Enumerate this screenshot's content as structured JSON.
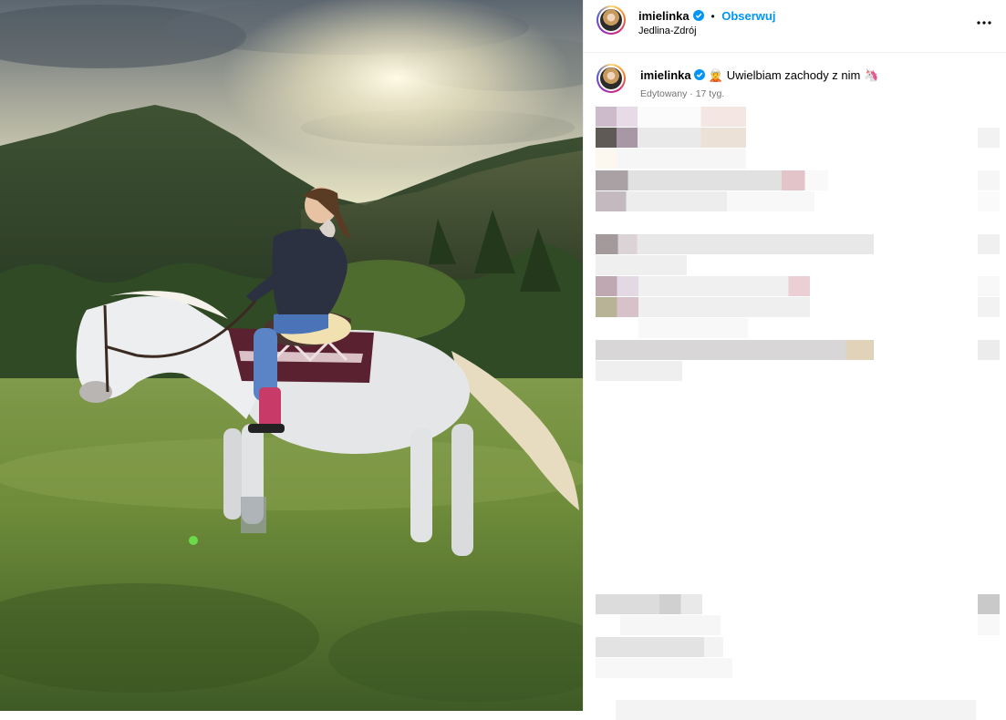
{
  "post": {
    "username": "imielinka",
    "separator": "•",
    "follow_label": "Obserwuj",
    "location": "Jedlina-Zdrój",
    "more_label": "•••",
    "caption": {
      "username": "imielinka",
      "text": "Uwielbiam zachody z nim",
      "emoji_start": "🧝",
      "emoji_end": "🦄",
      "edited": "Edytowany · 17 tyg."
    }
  },
  "colors": {
    "accent": "#0095f6",
    "verified": "#0095f6",
    "muted": "#737373"
  },
  "icons": [
    "verified-badge-icon",
    "more-options-icon",
    "elf-emoji-icon",
    "unicorn-emoji-icon"
  ],
  "photo": {
    "subject": "woman riding white horse at sunset in mountains"
  }
}
